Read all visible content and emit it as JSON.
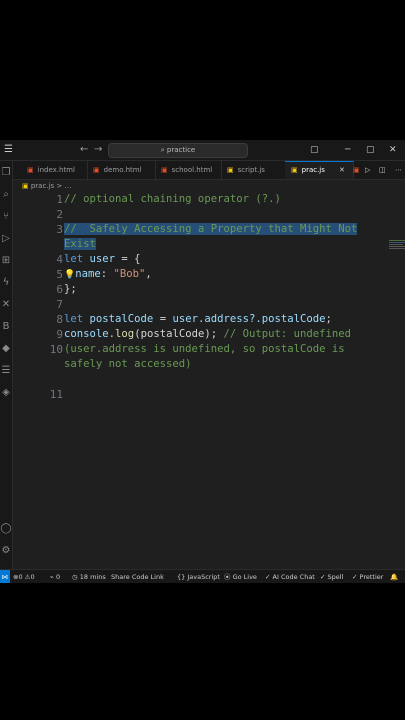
{
  "titlebar": {
    "search": "practice"
  },
  "tabs": [
    {
      "label": "index.html",
      "icon": "html-icon",
      "color": "#e44d26"
    },
    {
      "label": "demo.html",
      "icon": "html-icon",
      "color": "#e44d26"
    },
    {
      "label": "school.html",
      "icon": "html-icon",
      "color": "#e44d26"
    },
    {
      "label": "script.js",
      "icon": "js-icon",
      "color": "#f1c40f"
    },
    {
      "label": "prac.js",
      "icon": "js-icon",
      "color": "#f1c40f",
      "active": true
    }
  ],
  "breadcrumb": {
    "file": "prac.js",
    "more": ">"
  },
  "editor": {
    "line_numbers": [
      "1",
      "2",
      "3",
      "",
      "4",
      "5",
      "6",
      "7",
      "8",
      "9",
      "10",
      "",
      "",
      "11"
    ],
    "lines": {
      "l1": "// optional chaining operator (?.)",
      "l3a": "//  Safely Accessing a Property that Might Not",
      "l3b": "Exist",
      "l5_kw": "let",
      "l5_var": "user",
      "l5_rest": " = {",
      "l6_key": "name",
      "l6_colon": ": ",
      "l6_str": "\"Bob\"",
      "l6_end": ",",
      "l7": "};",
      "l9_kw": "let",
      "l9_var": "postalCode",
      "l9_eq": " = ",
      "l9_expr": "user.address?.postalCode",
      "l9_end": ";",
      "l10_obj": "console",
      "l10_dot": ".",
      "l10_fn": "log",
      "l10_arg": "(postalCode);",
      "l10_cm": " // Output: undefined",
      "l10b": "(user.address is undefined, so postalCode is",
      "l10c": "safely not accessed)"
    }
  },
  "statusbar": {
    "errors": "0",
    "warnings": "0",
    "ports": "0",
    "time": "18 mins",
    "share": "Share Code Link",
    "language": "JavaScript",
    "golive": "Go Live",
    "ai": "AI Code Chat",
    "spell": "Spell",
    "prettier": "Prettier"
  }
}
